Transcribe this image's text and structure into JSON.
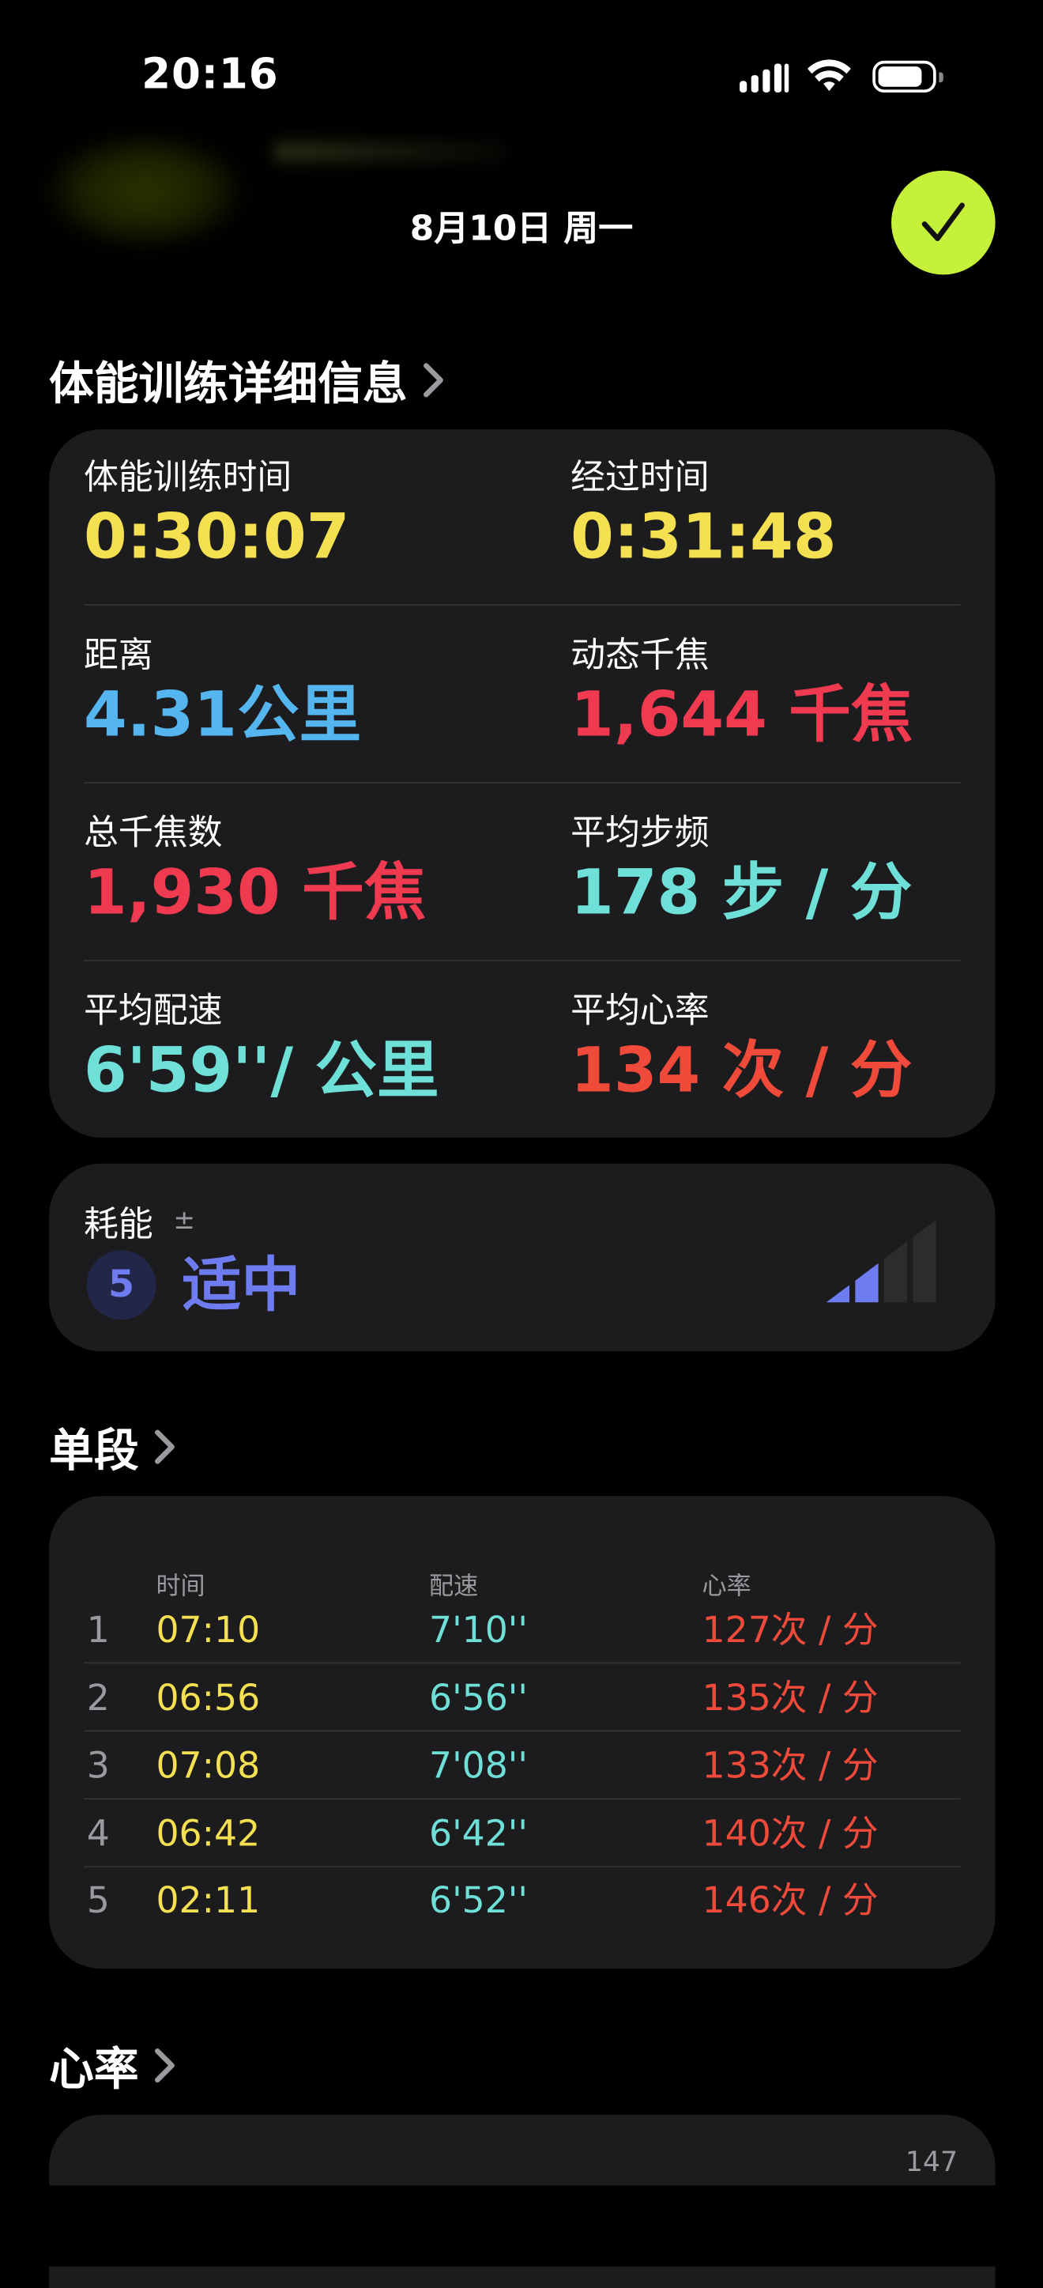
{
  "status_bar": {
    "time": "20:16"
  },
  "header": {
    "date": "8月10日 周一",
    "done_icon": "checkmark-icon",
    "done_color": "#c5f13a"
  },
  "workout_details": {
    "title": "体能训练详细信息",
    "metrics": [
      {
        "label": "体能训练时间",
        "value": "0:30:07",
        "color": "#f4e050"
      },
      {
        "label": "经过时间",
        "value": "0:31:48",
        "color": "#f4e050"
      },
      {
        "label": "距离",
        "value": "4.31公里",
        "color": "#55b6ef"
      },
      {
        "label": "动态千焦",
        "value": "1,644 千焦",
        "color": "#ef3a50"
      },
      {
        "label": "总千焦数",
        "value": "1,930 千焦",
        "color": "#ef3a50"
      },
      {
        "label": "平均步频",
        "value": "178 步 / 分",
        "color": "#6ee0d8"
      },
      {
        "label": "平均配速",
        "value": "6'59''/ 公里",
        "color": "#6ee0d8"
      },
      {
        "label": "平均心率",
        "value": "134 次 / 分",
        "color": "#ef4a3a"
      }
    ]
  },
  "effort": {
    "label": "耗能",
    "adjust_symbol": "±",
    "level": "5",
    "level_text": "适中",
    "level_fraction": 0.4,
    "color": "#6f7cf0"
  },
  "splits": {
    "title": "单段",
    "columns": [
      "时间",
      "配速",
      "心率"
    ],
    "rows": [
      {
        "index": "1",
        "time": "07:10",
        "pace": "7'10''",
        "hr": "127次 / 分"
      },
      {
        "index": "2",
        "time": "06:56",
        "pace": "6'56''",
        "hr": "135次 / 分"
      },
      {
        "index": "3",
        "time": "07:08",
        "pace": "7'08''",
        "hr": "133次 / 分"
      },
      {
        "index": "4",
        "time": "06:42",
        "pace": "6'42''",
        "hr": "140次 / 分"
      },
      {
        "index": "5",
        "time": "02:11",
        "pace": "6'52''",
        "hr": "146次 / 分"
      }
    ]
  },
  "heart_rate": {
    "title": "心率",
    "max_label": "147"
  }
}
